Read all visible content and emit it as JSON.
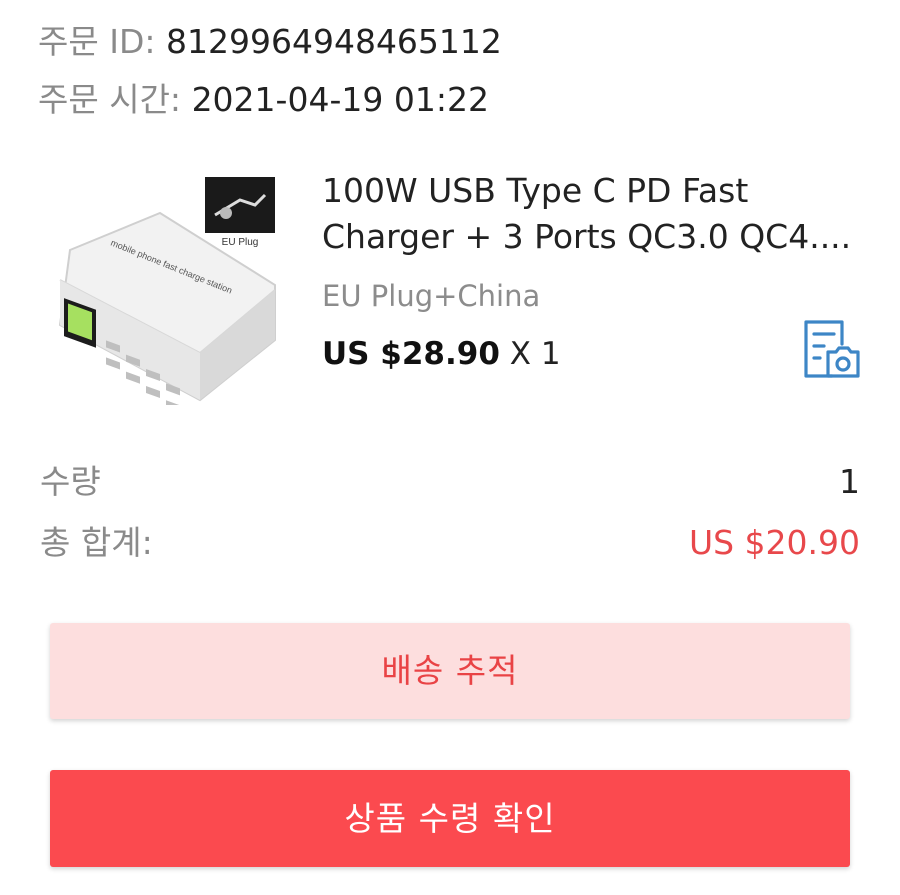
{
  "order": {
    "id_label": "주문 ID:",
    "id_value": "8129964948465112",
    "time_label": "주문 시간:",
    "time_value": "2021-04-19 01:22"
  },
  "product": {
    "title_line1": "100W USB Type C PD Fast",
    "title_line2": "Charger + 3 Ports QC3.0 QC4....",
    "variant": "EU Plug+China",
    "price": "US $28.90",
    "quantity_text": "X 1",
    "image_badge_text": "EU Plug",
    "image_product_text": "mobile phone fast charge station",
    "photo_review_icon": "document-camera-icon"
  },
  "summary": {
    "quantity_label": "수량",
    "quantity_value": "1",
    "total_label": "총 합계:",
    "total_value": "US $20.90"
  },
  "actions": {
    "track_label": "배송 추적",
    "confirm_label": "상품 수령 확인"
  },
  "colors": {
    "accent_red": "#e8484b",
    "confirm_button": "#fb4a4f",
    "track_button_bg": "#fddede",
    "icon_blue": "#3d86c6"
  }
}
